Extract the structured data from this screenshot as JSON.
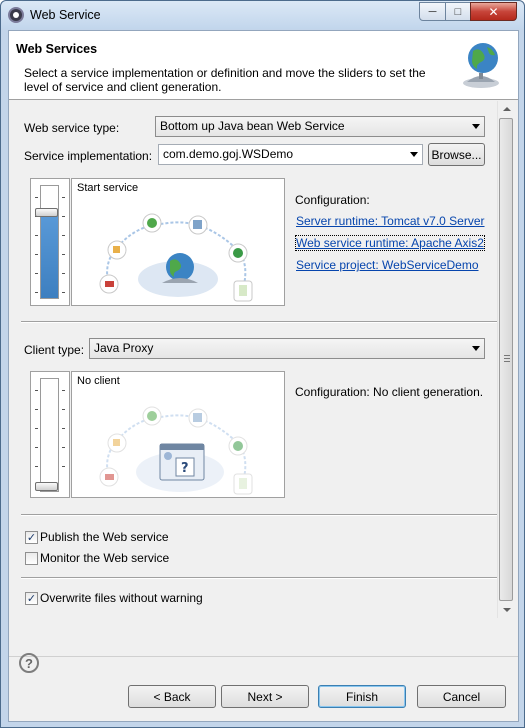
{
  "window": {
    "title": "Web Service"
  },
  "header": {
    "title": "Web Services",
    "description": "Select a service implementation or definition and move the sliders to set the level of service and client generation."
  },
  "service": {
    "type_label": "Web service type:",
    "type_value": "Bottom up Java bean Web Service",
    "impl_label": "Service implementation:",
    "impl_value": "com.demo.goj.WSDemo",
    "browse_label": "Browse...",
    "slider_caption": "Start service",
    "slider_level": "Start service",
    "config_label": "Configuration:",
    "links": {
      "server_runtime": "Server runtime: Tomcat v7.0 Server",
      "ws_runtime": "Web service runtime: Apache Axis2",
      "project": "Service project: WebServiceDemo"
    }
  },
  "client": {
    "type_label": "Client type:",
    "type_value": "Java Proxy",
    "slider_caption": "No client",
    "slider_level": "No client",
    "config_text": "Configuration: No client generation."
  },
  "options": {
    "publish": {
      "label": "Publish the Web service",
      "checked": true
    },
    "monitor": {
      "label": "Monitor the Web service",
      "checked": false
    },
    "overwrite": {
      "label": "Overwrite files without warning",
      "checked": true
    }
  },
  "buttons": {
    "back": "< Back",
    "next": "Next >",
    "finish": "Finish",
    "cancel": "Cancel"
  },
  "colors": {
    "link": "#0645ad",
    "slider_fill": "#5a9ad8"
  }
}
